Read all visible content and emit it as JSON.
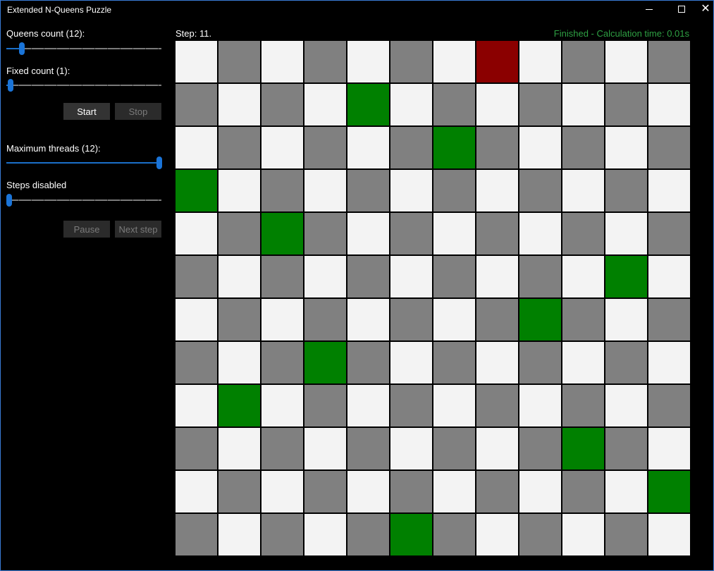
{
  "window": {
    "title": "Extended N-Queens Puzzle"
  },
  "controls": {
    "queens_label": "Queens count (12):",
    "queens_value": 12,
    "fixed_label": "Fixed count (1):",
    "fixed_value": 1,
    "start_label": "Start",
    "stop_label": "Stop",
    "threads_label": "Maximum threads (12):",
    "threads_value": 12,
    "steps_label": "Steps disabled",
    "steps_value": 0,
    "pause_label": "Pause",
    "next_label": "Next step"
  },
  "header": {
    "step_text": "Step: 11.",
    "status_text": "Finished - Calculation time: 0.01s"
  },
  "colors": {
    "light": "#f3f3f3",
    "dark": "#808080",
    "queen": "#008000",
    "fixed": "#8b0000",
    "accent": "#1a74d8",
    "status": "#2ea043"
  },
  "board": {
    "size": 12,
    "queens": [
      {
        "row": 0,
        "col": 7,
        "fixed": true
      },
      {
        "row": 1,
        "col": 4,
        "fixed": false
      },
      {
        "row": 2,
        "col": 6,
        "fixed": false
      },
      {
        "row": 3,
        "col": 0,
        "fixed": false
      },
      {
        "row": 4,
        "col": 2,
        "fixed": false
      },
      {
        "row": 5,
        "col": 10,
        "fixed": false
      },
      {
        "row": 6,
        "col": 8,
        "fixed": false
      },
      {
        "row": 7,
        "col": 3,
        "fixed": false
      },
      {
        "row": 8,
        "col": 1,
        "fixed": false
      },
      {
        "row": 9,
        "col": 9,
        "fixed": false
      },
      {
        "row": 10,
        "col": 11,
        "fixed": false
      },
      {
        "row": 11,
        "col": 5,
        "fixed": false
      }
    ]
  }
}
